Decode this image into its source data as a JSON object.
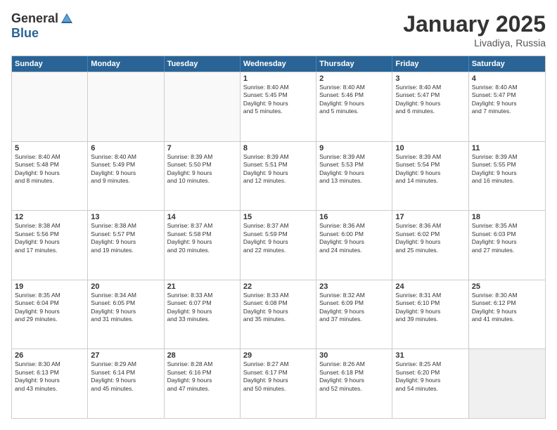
{
  "logo": {
    "general": "General",
    "blue": "Blue"
  },
  "title": "January 2025",
  "subtitle": "Livadiya, Russia",
  "header_days": [
    "Sunday",
    "Monday",
    "Tuesday",
    "Wednesday",
    "Thursday",
    "Friday",
    "Saturday"
  ],
  "rows": [
    [
      {
        "day": "",
        "lines": [],
        "empty": true
      },
      {
        "day": "",
        "lines": [],
        "empty": true
      },
      {
        "day": "",
        "lines": [],
        "empty": true
      },
      {
        "day": "1",
        "lines": [
          "Sunrise: 8:40 AM",
          "Sunset: 5:45 PM",
          "Daylight: 9 hours",
          "and 5 minutes."
        ]
      },
      {
        "day": "2",
        "lines": [
          "Sunrise: 8:40 AM",
          "Sunset: 5:46 PM",
          "Daylight: 9 hours",
          "and 5 minutes."
        ]
      },
      {
        "day": "3",
        "lines": [
          "Sunrise: 8:40 AM",
          "Sunset: 5:47 PM",
          "Daylight: 9 hours",
          "and 6 minutes."
        ]
      },
      {
        "day": "4",
        "lines": [
          "Sunrise: 8:40 AM",
          "Sunset: 5:47 PM",
          "Daylight: 9 hours",
          "and 7 minutes."
        ]
      }
    ],
    [
      {
        "day": "5",
        "lines": [
          "Sunrise: 8:40 AM",
          "Sunset: 5:48 PM",
          "Daylight: 9 hours",
          "and 8 minutes."
        ]
      },
      {
        "day": "6",
        "lines": [
          "Sunrise: 8:40 AM",
          "Sunset: 5:49 PM",
          "Daylight: 9 hours",
          "and 9 minutes."
        ]
      },
      {
        "day": "7",
        "lines": [
          "Sunrise: 8:39 AM",
          "Sunset: 5:50 PM",
          "Daylight: 9 hours",
          "and 10 minutes."
        ]
      },
      {
        "day": "8",
        "lines": [
          "Sunrise: 8:39 AM",
          "Sunset: 5:51 PM",
          "Daylight: 9 hours",
          "and 12 minutes."
        ]
      },
      {
        "day": "9",
        "lines": [
          "Sunrise: 8:39 AM",
          "Sunset: 5:53 PM",
          "Daylight: 9 hours",
          "and 13 minutes."
        ]
      },
      {
        "day": "10",
        "lines": [
          "Sunrise: 8:39 AM",
          "Sunset: 5:54 PM",
          "Daylight: 9 hours",
          "and 14 minutes."
        ]
      },
      {
        "day": "11",
        "lines": [
          "Sunrise: 8:39 AM",
          "Sunset: 5:55 PM",
          "Daylight: 9 hours",
          "and 16 minutes."
        ]
      }
    ],
    [
      {
        "day": "12",
        "lines": [
          "Sunrise: 8:38 AM",
          "Sunset: 5:56 PM",
          "Daylight: 9 hours",
          "and 17 minutes."
        ]
      },
      {
        "day": "13",
        "lines": [
          "Sunrise: 8:38 AM",
          "Sunset: 5:57 PM",
          "Daylight: 9 hours",
          "and 19 minutes."
        ]
      },
      {
        "day": "14",
        "lines": [
          "Sunrise: 8:37 AM",
          "Sunset: 5:58 PM",
          "Daylight: 9 hours",
          "and 20 minutes."
        ]
      },
      {
        "day": "15",
        "lines": [
          "Sunrise: 8:37 AM",
          "Sunset: 5:59 PM",
          "Daylight: 9 hours",
          "and 22 minutes."
        ]
      },
      {
        "day": "16",
        "lines": [
          "Sunrise: 8:36 AM",
          "Sunset: 6:00 PM",
          "Daylight: 9 hours",
          "and 24 minutes."
        ]
      },
      {
        "day": "17",
        "lines": [
          "Sunrise: 8:36 AM",
          "Sunset: 6:02 PM",
          "Daylight: 9 hours",
          "and 25 minutes."
        ]
      },
      {
        "day": "18",
        "lines": [
          "Sunrise: 8:35 AM",
          "Sunset: 6:03 PM",
          "Daylight: 9 hours",
          "and 27 minutes."
        ]
      }
    ],
    [
      {
        "day": "19",
        "lines": [
          "Sunrise: 8:35 AM",
          "Sunset: 6:04 PM",
          "Daylight: 9 hours",
          "and 29 minutes."
        ]
      },
      {
        "day": "20",
        "lines": [
          "Sunrise: 8:34 AM",
          "Sunset: 6:05 PM",
          "Daylight: 9 hours",
          "and 31 minutes."
        ]
      },
      {
        "day": "21",
        "lines": [
          "Sunrise: 8:33 AM",
          "Sunset: 6:07 PM",
          "Daylight: 9 hours",
          "and 33 minutes."
        ]
      },
      {
        "day": "22",
        "lines": [
          "Sunrise: 8:33 AM",
          "Sunset: 6:08 PM",
          "Daylight: 9 hours",
          "and 35 minutes."
        ]
      },
      {
        "day": "23",
        "lines": [
          "Sunrise: 8:32 AM",
          "Sunset: 6:09 PM",
          "Daylight: 9 hours",
          "and 37 minutes."
        ]
      },
      {
        "day": "24",
        "lines": [
          "Sunrise: 8:31 AM",
          "Sunset: 6:10 PM",
          "Daylight: 9 hours",
          "and 39 minutes."
        ]
      },
      {
        "day": "25",
        "lines": [
          "Sunrise: 8:30 AM",
          "Sunset: 6:12 PM",
          "Daylight: 9 hours",
          "and 41 minutes."
        ]
      }
    ],
    [
      {
        "day": "26",
        "lines": [
          "Sunrise: 8:30 AM",
          "Sunset: 6:13 PM",
          "Daylight: 9 hours",
          "and 43 minutes."
        ]
      },
      {
        "day": "27",
        "lines": [
          "Sunrise: 8:29 AM",
          "Sunset: 6:14 PM",
          "Daylight: 9 hours",
          "and 45 minutes."
        ]
      },
      {
        "day": "28",
        "lines": [
          "Sunrise: 8:28 AM",
          "Sunset: 6:16 PM",
          "Daylight: 9 hours",
          "and 47 minutes."
        ]
      },
      {
        "day": "29",
        "lines": [
          "Sunrise: 8:27 AM",
          "Sunset: 6:17 PM",
          "Daylight: 9 hours",
          "and 50 minutes."
        ]
      },
      {
        "day": "30",
        "lines": [
          "Sunrise: 8:26 AM",
          "Sunset: 6:18 PM",
          "Daylight: 9 hours",
          "and 52 minutes."
        ]
      },
      {
        "day": "31",
        "lines": [
          "Sunrise: 8:25 AM",
          "Sunset: 6:20 PM",
          "Daylight: 9 hours",
          "and 54 minutes."
        ]
      },
      {
        "day": "",
        "lines": [],
        "empty": true,
        "shaded": true
      }
    ]
  ]
}
